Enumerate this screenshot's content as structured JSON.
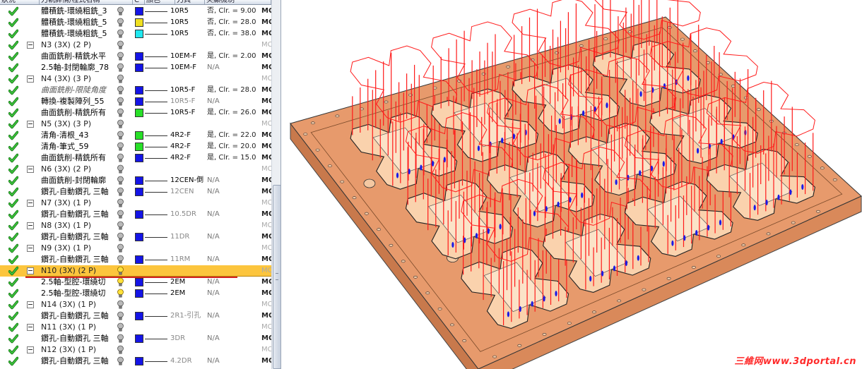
{
  "tree": {
    "headers": [
      {
        "key": "status",
        "label": "狀況"
      },
      {
        "key": "name",
        "label": "刀軌詳情/程式名稱"
      },
      {
        "key": "c",
        "label": "C"
      },
      {
        "key": "color",
        "label": "顏色"
      },
      {
        "key": "tool",
        "label": "刀具"
      },
      {
        "key": "feature",
        "label": "突顯機制"
      }
    ],
    "rows": [
      {
        "type": "child",
        "name": "體積銑-環繞粗銑_3",
        "swatch": "#1414e6",
        "tool": "10R5",
        "tool_gray": false,
        "clr": "否, Clr. = 9.00",
        "mc": "MC"
      },
      {
        "type": "child",
        "name": "體積銑-環繞粗銑_5",
        "swatch": "#f0e020",
        "tool": "10R5",
        "tool_gray": false,
        "clr": "否, Clr. = 28.0",
        "mc": "MC"
      },
      {
        "type": "child",
        "name": "體積銑-環繞粗銑_5",
        "swatch": "#20e8f0",
        "tool": "10R5",
        "tool_gray": false,
        "clr": "否, Clr. = 38.0",
        "mc": "MC"
      },
      {
        "type": "group",
        "name": "N3 (3X) (2 P)",
        "mc": "MC"
      },
      {
        "type": "child",
        "name": "曲面銑削-精銑水平",
        "swatch": "#1414e6",
        "tool": "10EM-F",
        "tool_gray": false,
        "clr": "是, Clr. = 2.00",
        "mc": "MC"
      },
      {
        "type": "child",
        "name": "2.5軸-封閉輪廓_78",
        "swatch": "#1414e6",
        "tool": "10EM-F",
        "tool_gray": false,
        "clr": "N/A",
        "mc": "MC"
      },
      {
        "type": "group",
        "name": "N4 (3X) (3 P)",
        "mc": "MC"
      },
      {
        "type": "child",
        "name": "曲面銑削-限陡角度",
        "italic": true,
        "swatch": "#1414e6",
        "tool": "10R5-F",
        "tool_gray": false,
        "clr": "是, Clr. = 28.0",
        "mc": "MC"
      },
      {
        "type": "child",
        "name": "轉換-複製陣列_55",
        "swatch": "#1414e6",
        "tool": "10R5-F",
        "tool_gray": true,
        "clr": "N/A",
        "mc": "MC"
      },
      {
        "type": "child",
        "name": "曲面銑削-精銑所有",
        "swatch": "#28e028",
        "tool": "10R5-F",
        "tool_gray": false,
        "clr": "是, Clr. = 26.0",
        "mc": "MC"
      },
      {
        "type": "group",
        "name": "N5 (3X) (3 P)",
        "mc": "MC"
      },
      {
        "type": "child",
        "name": "清角-清根_43",
        "swatch": "#28e028",
        "tool": "4R2-F",
        "tool_gray": false,
        "clr": "是, Clr. = 22.0",
        "mc": "MC"
      },
      {
        "type": "child",
        "name": "清角-筆式_59",
        "swatch": "#28e028",
        "tool": "4R2-F",
        "tool_gray": false,
        "clr": "是, Clr. = 20.0",
        "mc": "MC"
      },
      {
        "type": "child",
        "name": "曲面銑削-精銑所有",
        "swatch": "#1414e6",
        "tool": "4R2-F",
        "tool_gray": false,
        "clr": "是, Clr. = 15.0",
        "mc": "MC"
      },
      {
        "type": "group",
        "name": "N6 (3X) (2 P)",
        "mc": "MC"
      },
      {
        "type": "child",
        "name": "曲面銑削-封閉輪廓",
        "swatch": "#1414e6",
        "tool": "12CEN-倒",
        "tool_gray": false,
        "clr": "N/A",
        "mc": "MC"
      },
      {
        "type": "child",
        "name": "鑽孔-自動鑽孔 三軸",
        "swatch": "#1414e6",
        "tool": "12CEN",
        "tool_gray": true,
        "clr": "N/A",
        "mc": "MC"
      },
      {
        "type": "group",
        "name": "N7 (3X) (1 P)",
        "mc": "MC"
      },
      {
        "type": "child",
        "name": "鑽孔-自動鑽孔 三軸",
        "swatch": "#1414e6",
        "tool": "10.5DR",
        "tool_gray": true,
        "clr": "N/A",
        "mc": "MC"
      },
      {
        "type": "group",
        "name": "N8 (3X) (1 P)",
        "mc": "MC"
      },
      {
        "type": "child",
        "name": "鑽孔-自動鑽孔 三軸",
        "swatch": "#1414e6",
        "tool": "11DR",
        "tool_gray": true,
        "clr": "N/A",
        "mc": "MC"
      },
      {
        "type": "group",
        "name": "N9 (3X) (1 P)",
        "mc": "MC"
      },
      {
        "type": "child",
        "name": "鑽孔-自動鑽孔 三軸",
        "swatch": "#1414e6",
        "tool": "11RM",
        "tool_gray": true,
        "clr": "N/A",
        "mc": "MC"
      },
      {
        "type": "group",
        "name": "N10 (3X) (2 P)",
        "selected": true,
        "bulb_on": true,
        "mc": "MC"
      },
      {
        "type": "child",
        "name": "2.5軸-型腔-環繞切",
        "bulb_on": true,
        "swatch": "#1414e6",
        "tool": "2EM",
        "tool_gray": false,
        "clr": "N/A",
        "mc": "MC"
      },
      {
        "type": "child",
        "name": "2.5軸-型腔-環繞切",
        "bulb_on": true,
        "swatch": "#1414e6",
        "tool": "2EM",
        "tool_gray": false,
        "clr": "N/A",
        "mc": "MC"
      },
      {
        "type": "group",
        "name": "N14 (3X) (1 P)",
        "mc": "MC"
      },
      {
        "type": "child",
        "name": "鑽孔-自動鑽孔 三軸",
        "swatch": "#1414e6",
        "tool": "2R1-引孔",
        "tool_gray": true,
        "clr": "N/A",
        "mc": "MC"
      },
      {
        "type": "group",
        "name": "N11 (3X) (1 P)",
        "mc": "MC"
      },
      {
        "type": "child",
        "name": "鑽孔-自動鑽孔 三軸",
        "swatch": "#1414e6",
        "tool": "3DR",
        "tool_gray": true,
        "clr": "N/A",
        "mc": "MC"
      },
      {
        "type": "group",
        "name": "N12 (3X) (1 P)",
        "mc": "MC"
      },
      {
        "type": "child",
        "name": "鑽孔-自動鑽孔 三軸",
        "swatch": "#1414e6",
        "tool": "4.2DR",
        "tool_gray": true,
        "clr": "N/A",
        "mc": "MC"
      }
    ]
  },
  "viewport": {
    "part_color": "#e79a6c",
    "pocket_color": "#fad2ad",
    "toolpath_color": "#ff1a1a",
    "mark_color": "#1a1ae6",
    "watermark": "三維网www.3dportal.cn"
  },
  "colors": {
    "selected_row": "#fcc53d",
    "status_ok": "#2fa82f"
  }
}
